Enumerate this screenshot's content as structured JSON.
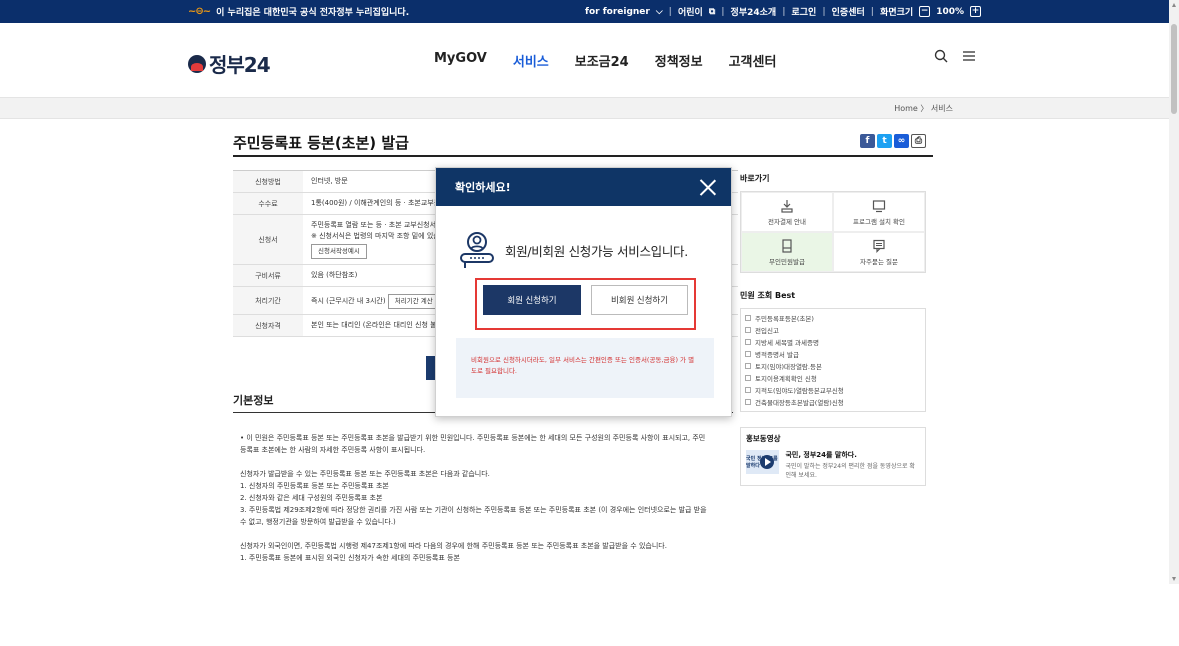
{
  "govbar": {
    "notice": "이 누리집은 대한민국 공식 전자정부 누리집입니다.",
    "foreigner": "for foreigner",
    "kids": "어린이",
    "intro": "정부24소개",
    "login": "로그인",
    "cert": "인증센터",
    "screen_size": "화면크기",
    "zoom": "100%",
    "minus": "−",
    "plus": "+"
  },
  "header": {
    "logo": "정부24",
    "nav": [
      "MyGOV",
      "서비스",
      "보조금24",
      "정책정보",
      "고객센터"
    ],
    "active_nav": "서비스"
  },
  "breadcrumb": "Home 〉 서비스",
  "page": {
    "title": "주민등록표 등본(초본) 발급"
  },
  "info_table": [
    {
      "key": "신청방법",
      "value": "인터넷, 방문"
    },
    {
      "key": "수수료",
      "value": "1통(400원) / 이해관계인의 등 · 초본교부는 ..."
    },
    {
      "key": "신청서",
      "value": "주민등록표 열람 또는 등 · 초본 교부신청서 ...",
      "value2": "※ 신청서식은 법령의 마지막 조항 밑에 있습니다.",
      "button": "신청서작성예시"
    },
    {
      "key": "구비서류",
      "value": "있음 (하단참조)"
    },
    {
      "key": "처리기간",
      "value": "즉시 (근무시간 내 3시간)",
      "button": "처리기간 계산 방법"
    },
    {
      "key": "신청자격",
      "value": "본인 또는 대리인 (온라인은 대리인 신청 불가)"
    }
  ],
  "section": {
    "heading": "기본정보",
    "paragraphs": [
      "• 이 민원은 주민등록표 등본 또는 주민등록표 초본을 발급받기 위한 민원입니다. 주민등록표 등본에는 한 세대의 모든 구성원의 주민등록 사항이 표시되고, 주민등록표 초본에는 한 사람의 자세한 주민등록 사항이 표시됩니다.",
      "",
      "신청자가 발급받을 수 있는 주민등록표 등본 또는 주민등록표 초본은 다음과 같습니다.",
      "1. 신청자의 주민등록표 등본 또는 주민등록표 초본",
      "2. 신청자와 같은 세대 구성원의 주민등록표 초본",
      "3. 주민등록법 제29조제2항에 따라 정당한 권리를 가진 사람 또는 기관이 신청하는 주민등록표 등본 또는 주민등록표 초본 (이 경우에는 인터넷으로는 발급 받을 수 없고, 행정기관을 방문하여 발급받을 수 있습니다.)",
      "",
      "신청자가 외국인이면, 주민등록법 시행령 제47조제1항에 따라 다음의 경우에 한해 주민등록표 등본 또는 주민등록표 초본을 발급받을 수 있습니다.",
      "1. 주민등록표 등본에 표시된 외국인 신청자가 속한 세대의 주민등록표 등본"
    ]
  },
  "sidebar": {
    "quick_title": "바로가기",
    "quick_items": [
      {
        "label": "전자결제 안내",
        "icon": "payment-icon"
      },
      {
        "label": "프로그램 설치 확인",
        "icon": "monitor-icon"
      },
      {
        "label": "무인민원발급",
        "icon": "kiosk-icon"
      },
      {
        "label": "자주묻는 질문",
        "icon": "faq-icon"
      }
    ],
    "best_title": "민원 조회 Best",
    "best_items": [
      "주민등록표등본(초본)",
      "전입신고",
      "지방세 세목별 과세증명",
      "병적증명서 발급",
      "토지(임야)대장열람.등본",
      "토지이용계획확인 신청",
      "지적도(임야도)열람등본교부신청",
      "건축물대장등초본발급(열람)신청"
    ],
    "promo_title": "홍보동영상",
    "promo_thumb": "국민 정부24를 말하다",
    "promo_headline": "국민, 정부24를 말하다.",
    "promo_desc": "국민이 말하는 정부24의 편리한 점을 동영상으로 확인해 보세요."
  },
  "modal": {
    "title": "확인하세요!",
    "message": "회원/비회원 신청가능 서비스입니다.",
    "member_btn": "회원 신청하기",
    "guest_btn": "비회원 신청하기",
    "notice": "비회원으로 신청하시더라도, 일부 서비스는 간편인증 또는 인증서(공동,금융) 가 별도로 필요합니다."
  },
  "colors": {
    "govbar": "#0b2f6b",
    "modal_header": "#0f3566",
    "primary_button": "#1c3766",
    "highlight_border": "#e53935",
    "notice_text": "#d32f2f",
    "active_nav": "#1a5dd8"
  }
}
